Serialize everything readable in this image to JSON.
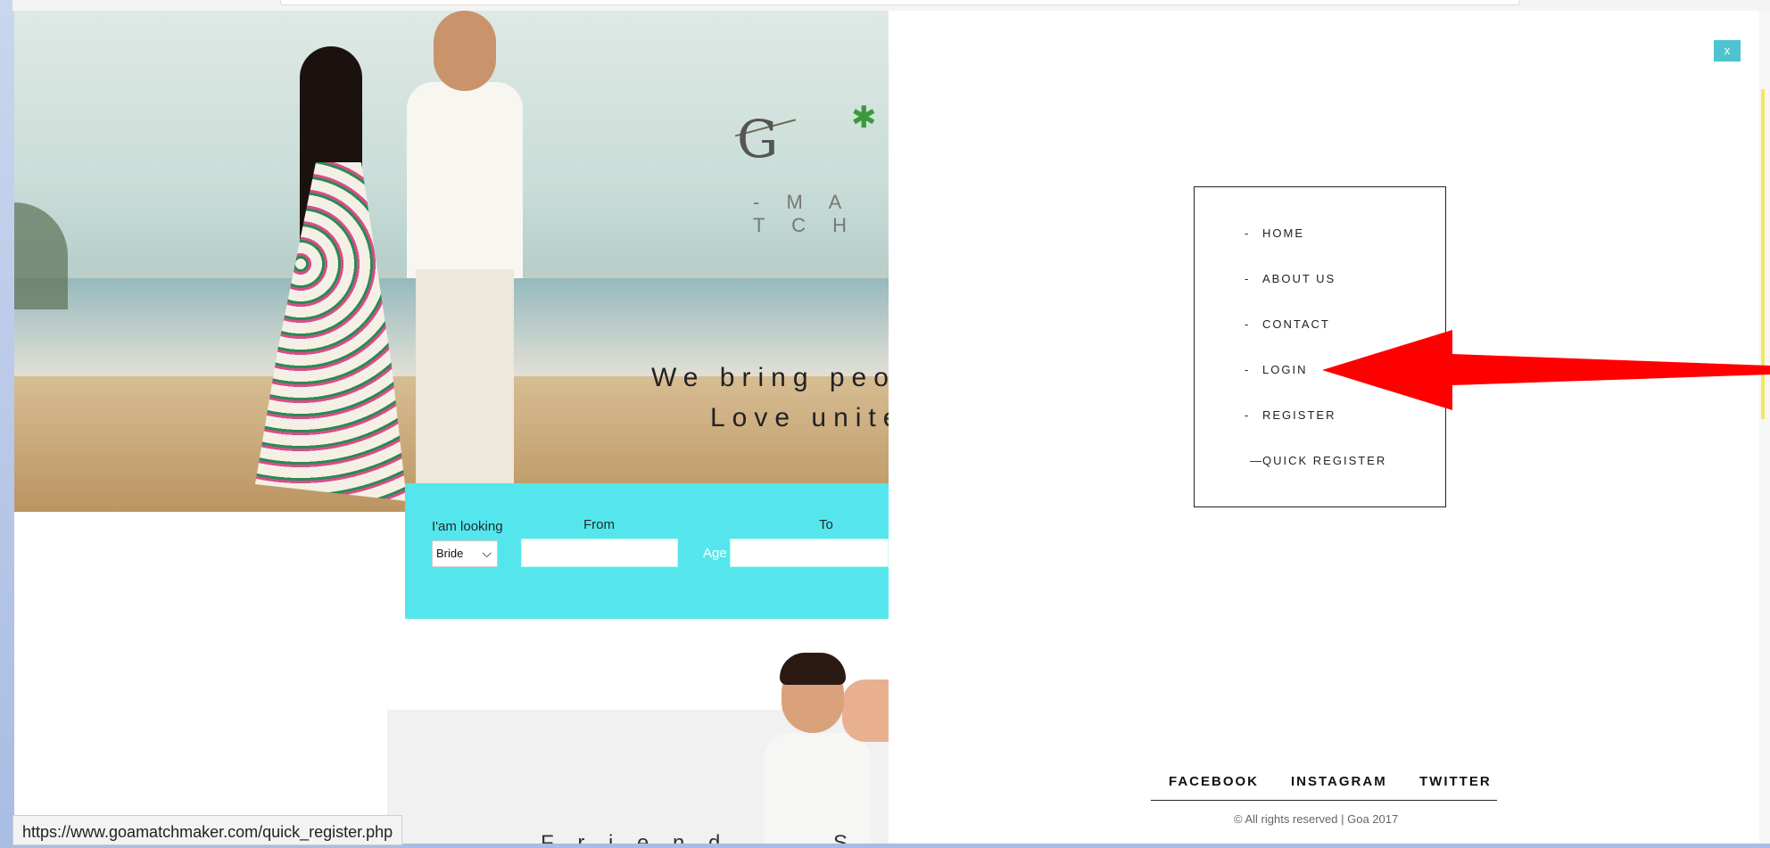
{
  "browser": {
    "status_url": "https://www.goamatchmaker.com/quick_register.php"
  },
  "hero": {
    "logo_letter": "G",
    "logo_subtext": "- M A T C H",
    "tagline_line1": "We bring peo",
    "tagline_line2": "Love unite"
  },
  "search": {
    "looking_label": "I'am looking",
    "looking_value": "Bride",
    "from_label": "From",
    "age_label": "Age",
    "to_label": "To"
  },
  "lower": {
    "teaser_text": "F r i e n d  . . .  S . . ."
  },
  "overlay": {
    "close_label": "x",
    "menu": [
      {
        "dash": "-",
        "label": "HOME"
      },
      {
        "dash": "-",
        "label": "ABOUT US"
      },
      {
        "dash": "-",
        "label": "CONTACT"
      },
      {
        "dash": "-",
        "label": "LOGIN"
      },
      {
        "dash": "-",
        "label": "REGISTER"
      },
      {
        "dash": "—",
        "label": "QUICK REGISTER"
      }
    ],
    "social": {
      "facebook": "FACEBOOK",
      "instagram": "INSTAGRAM",
      "twitter": "TWITTER"
    },
    "copyright": "© All rights reserved | Goa 2017"
  },
  "colors": {
    "search_bar": "#55e6ed",
    "close_button": "#4fc3cf",
    "annotation_arrow": "#ff0000"
  },
  "icons": {
    "select_chevron": "chevron-down-icon",
    "annotation": "red-arrow-icon"
  }
}
